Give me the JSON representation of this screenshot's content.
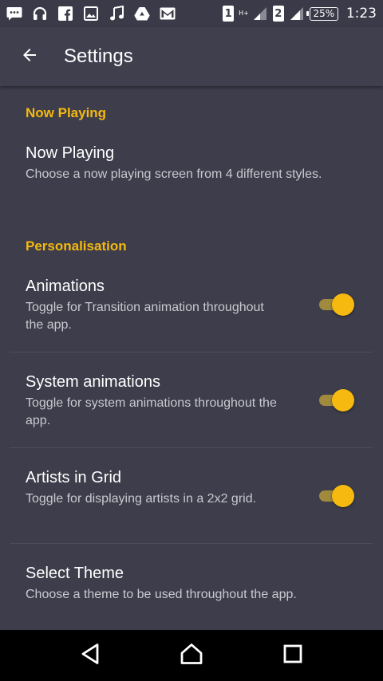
{
  "status_bar": {
    "left_icons": [
      "chat-icon",
      "headphones-icon",
      "facebook-icon",
      "image-icon",
      "music-note-icon",
      "google-drive-icon",
      "gmail-icon"
    ],
    "sim1_label": "1",
    "network_type": "H+",
    "sim2_label": "2",
    "battery": "25%",
    "time": "1:23"
  },
  "toolbar": {
    "back_icon": "arrow-back-icon",
    "title": "Settings"
  },
  "categories": {
    "now_playing": "Now Playing",
    "personalisation": "Personalisation"
  },
  "prefs": {
    "now_playing": {
      "title": "Now Playing",
      "summary": "Choose a now playing screen from 4 different styles."
    },
    "animations": {
      "title": "Animations",
      "summary": "Toggle for Transition animation throughout the app.",
      "enabled": true
    },
    "system_animations": {
      "title": "System animations",
      "summary": "Toggle for system animations throughout the app.",
      "enabled": true
    },
    "artists_grid": {
      "title": "Artists in Grid",
      "summary": "Toggle for displaying artists in a 2x2 grid.",
      "enabled": true
    },
    "select_theme": {
      "title": "Select Theme",
      "summary": "Choose a theme to be used throughout the app."
    }
  },
  "colors": {
    "accent": "#f5b90f",
    "background": "#3d3d4b",
    "toolbar": "#3f3f4e",
    "nav_bar": "#000000"
  },
  "nav_bar": {
    "icons": [
      "back-triangle-icon",
      "home-icon",
      "recents-icon"
    ]
  }
}
